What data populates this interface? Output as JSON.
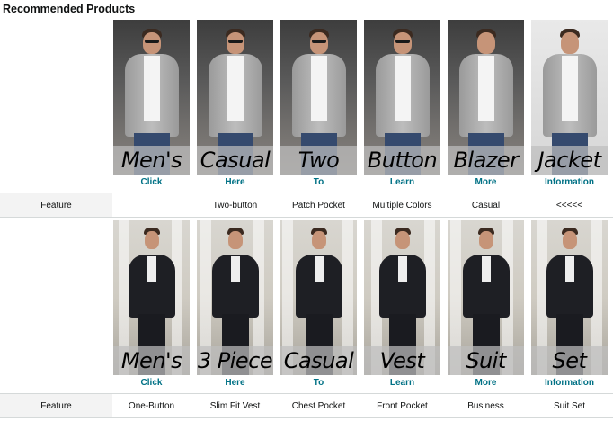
{
  "section": {
    "title": "Recommended Products"
  },
  "rows": [
    {
      "products": [
        {
          "overlay": "Men's",
          "link": "Click"
        },
        {
          "overlay": "Casual",
          "link": "Here"
        },
        {
          "overlay": "Two",
          "link": "To"
        },
        {
          "overlay": "Button",
          "link": "Learn"
        },
        {
          "overlay": "Blazer",
          "link": "More"
        },
        {
          "overlay": "Jacket",
          "link": "Information"
        }
      ],
      "feature": {
        "label": "Feature",
        "values": [
          "",
          "Two-button",
          "Patch Pocket",
          "Multiple Colors",
          "Casual",
          "<<<<<"
        ]
      }
    },
    {
      "products": [
        {
          "overlay": "Men's",
          "link": "Click"
        },
        {
          "overlay": "3 Piece",
          "link": "Here"
        },
        {
          "overlay": "Casual",
          "link": "To"
        },
        {
          "overlay": "Vest",
          "link": "Learn"
        },
        {
          "overlay": "Suit",
          "link": "More"
        },
        {
          "overlay": "Set",
          "link": "Information"
        }
      ],
      "feature": {
        "label": "Feature",
        "values": [
          "One-Button",
          "Slim Fit Vest",
          "Chest Pocket",
          "Front Pocket",
          "Business",
          "Suit Set"
        ]
      }
    }
  ],
  "colors": {
    "link": "#007185",
    "feature_label_bg": "#f3f3f3",
    "border": "#d5d9d9"
  }
}
